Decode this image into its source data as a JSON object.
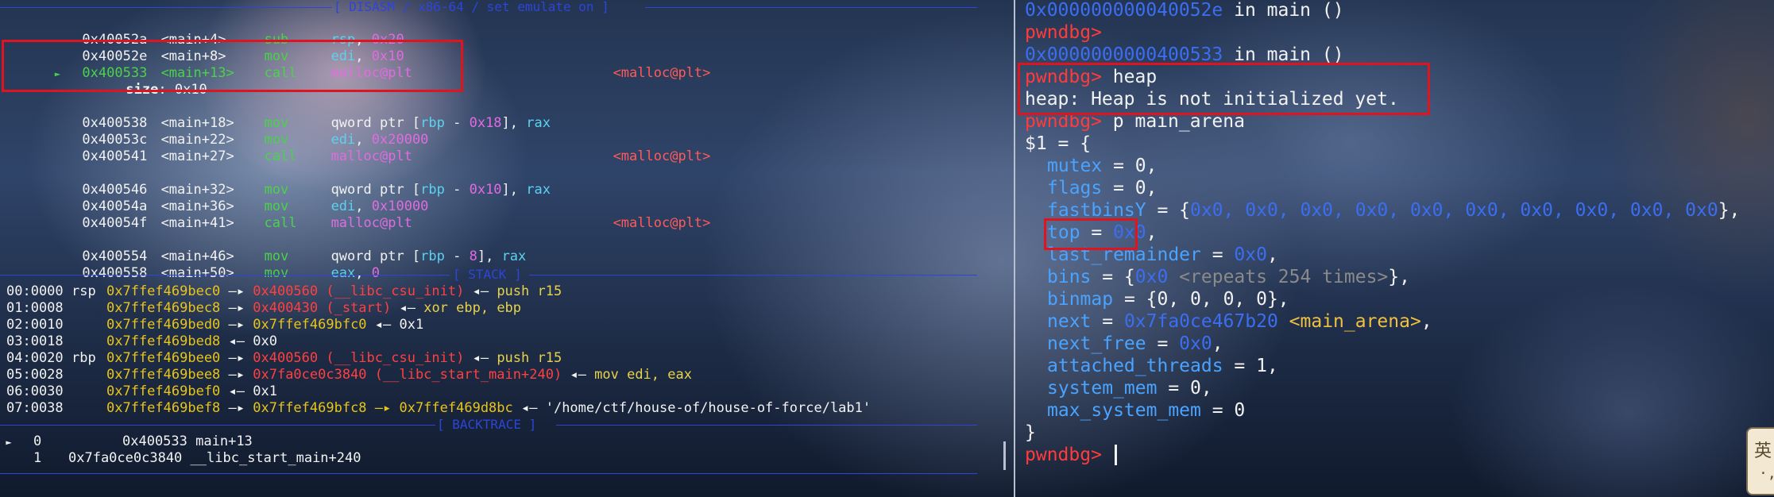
{
  "left": {
    "headers": {
      "disasm": "[ DISASM / x86-64 / set emulate on ]",
      "stack": "[ STACK ]",
      "backtrace": "[ BACKTRACE ]"
    },
    "disasm": [
      {
        "marker": "",
        "addr": "0x40052a",
        "sym": "<main+4>",
        "op": "sub",
        "a1": "rsp",
        "a2": ", ",
        "a3": "0x20",
        "extra": ""
      },
      {
        "marker": "",
        "addr": "0x40052e",
        "sym": "<main+8>",
        "op": "mov",
        "a1": "edi",
        "a2": ", ",
        "a3": "0x10",
        "extra": ""
      },
      {
        "marker": "►",
        "addr": "0x400533",
        "sym": "<main+13>",
        "op": "call",
        "a1": "malloc@plt",
        "a2": "",
        "a3": "",
        "extra": "<malloc@plt>"
      },
      {
        "marker": "",
        "addr": "",
        "sym": "",
        "op": "",
        "a1": "",
        "a2": "",
        "a3": "",
        "extra": "",
        "note_key": "size",
        "note_val": ": 0x10"
      },
      {
        "marker": "",
        "addr": "0x400538",
        "sym": "<main+18>",
        "op": "mov",
        "a1": "qword ptr [",
        "a1b": "rbp",
        "a1c": " - ",
        "a1d": "0x18",
        "a1e": "], ",
        "a1f": "rax",
        "extra": ""
      },
      {
        "marker": "",
        "addr": "0x40053c",
        "sym": "<main+22>",
        "op": "mov",
        "a1": "edi",
        "a2": ", ",
        "a3": "0x20000",
        "extra": ""
      },
      {
        "marker": "",
        "addr": "0x400541",
        "sym": "<main+27>",
        "op": "call",
        "a1": "malloc@plt",
        "a2": "",
        "a3": "",
        "extra": "<malloc@plt>"
      },
      {
        "marker": "",
        "addr": "0x400546",
        "sym": "<main+32>",
        "op": "mov",
        "a1": "qword ptr [",
        "a1b": "rbp",
        "a1c": " - ",
        "a1d": "0x10",
        "a1e": "], ",
        "a1f": "rax",
        "extra": ""
      },
      {
        "marker": "",
        "addr": "0x40054a",
        "sym": "<main+36>",
        "op": "mov",
        "a1": "edi",
        "a2": ", ",
        "a3": "0x10000",
        "extra": ""
      },
      {
        "marker": "",
        "addr": "0x40054f",
        "sym": "<main+41>",
        "op": "call",
        "a1": "malloc@plt",
        "a2": "",
        "a3": "",
        "extra": "<malloc@plt>"
      },
      {
        "marker": "",
        "addr": "0x400554",
        "sym": "<main+46>",
        "op": "mov",
        "a1": "qword ptr [",
        "a1b": "rbp",
        "a1c": " - ",
        "a1d": "8",
        "a1e": "], ",
        "a1f": "rax",
        "extra": ""
      },
      {
        "marker": "",
        "addr": "0x400558",
        "sym": "<main+50>",
        "op": "mov",
        "a1": "eax",
        "a2": ", ",
        "a3": "0",
        "extra": ""
      }
    ],
    "stack": [
      {
        "off": "00:0000",
        "reg": "rsp",
        "addr": "0x7ffef469bec0",
        "arrow": " —▸ ",
        "target": "0x400560 (__libc_csu_init)",
        "tail_arrow": " ◂— ",
        "tail": "push r15"
      },
      {
        "off": "01:0008",
        "reg": "",
        "addr": "0x7ffef469bec8",
        "arrow": " —▸ ",
        "target": "0x400430 (_start)",
        "tail_arrow": " ◂— ",
        "tail": "xor ebp, ebp"
      },
      {
        "off": "02:0010",
        "reg": "",
        "addr": "0x7ffef469bed0",
        "arrow": " —▸ ",
        "target": "0x7ffef469bfc0",
        "tail_arrow": " ◂— ",
        "tail": "0x1"
      },
      {
        "off": "03:0018",
        "reg": "",
        "addr": "0x7ffef469bed8",
        "arrow": "",
        "target": "",
        "tail_arrow": " ◂— ",
        "tail": "0x0"
      },
      {
        "off": "04:0020",
        "reg": "rbp",
        "addr": "0x7ffef469bee0",
        "arrow": " —▸ ",
        "target": "0x400560 (__libc_csu_init)",
        "tail_arrow": " ◂— ",
        "tail": "push r15"
      },
      {
        "off": "05:0028",
        "reg": "",
        "addr": "0x7ffef469bee8",
        "arrow": " —▸ ",
        "target": "0x7fa0ce0c3840 (__libc_start_main+240)",
        "tail_arrow": " ◂— ",
        "tail": "mov edi, eax"
      },
      {
        "off": "06:0030",
        "reg": "",
        "addr": "0x7ffef469bef0",
        "arrow": "",
        "target": "",
        "tail_arrow": " ◂— ",
        "tail": "0x1"
      },
      {
        "off": "07:0038",
        "reg": "",
        "addr": "0x7ffef469bef8",
        "arrow": " —▸ ",
        "target": "0x7ffef469bfc8 —▸ 0x7ffef469d8bc",
        "tail_arrow": " ◂— ",
        "tail": "'/home/ctf/house-of/house-of-force/lab1'"
      }
    ],
    "backtrace": [
      {
        "marker": "►",
        "idx": "0",
        "addr": "0x400533",
        "fn": "main+13"
      },
      {
        "marker": "",
        "idx": "1",
        "addr": "0x7fa0ce0c3840",
        "fn": "__libc_start_main+240"
      }
    ]
  },
  "right": {
    "prompt": "pwndbg> ",
    "lines": {
      "frame1_addr": "0x000000000040052e",
      "frame1_rest": " in main ()",
      "prompt1": "pwndbg>",
      "frame2_addr": "0x0000000000400533",
      "frame2_rest": " in main ()",
      "cmd_heap": "heap",
      "heap_msg": "heap: Heap is not initialized yet.",
      "cmd_p": "p main_arena",
      "result_head": "$1 = {",
      "mutex_k": "mutex",
      "mutex_v": " = 0,",
      "flags_k": "flags",
      "flags_v": " = 0,",
      "fastbins_k": "fastbinsY",
      "fastbins_pre": " = {",
      "fastbins_vals": "0x0, 0x0, 0x0, 0x0, 0x0, 0x0, 0x0, 0x0, 0x0, 0x0",
      "fastbins_post": "},",
      "top_k": "top",
      "top_eq": " = ",
      "top_v": "0x0",
      "top_post": ",",
      "lr_k": "last_remainder",
      "lr_eq": " = ",
      "lr_v": "0x0",
      "lr_post": ",",
      "bins_k": "bins",
      "bins_pre": " = {",
      "bins_v": "0x0",
      "bins_rep": " <repeats 254 times>",
      "bins_post": "},",
      "binmap_k": "binmap",
      "binmap_v": " = {0, 0, 0, 0},",
      "next_k": "next",
      "next_eq": " = ",
      "next_v": "0x7fa0ce467b20",
      "next_sym": " <main_arena>",
      "next_post": ",",
      "nextfree_k": "next_free",
      "nextfree_eq": " = ",
      "nextfree_v": "0x0",
      "nextfree_post": ",",
      "at_k": "attached_threads",
      "at_v": " = 1,",
      "sm_k": "system_mem",
      "sm_v": " = 0,",
      "msm_k": "max_system_mem",
      "msm_v": " = 0",
      "close": "}",
      "prompt_last": "pwndbg> "
    }
  },
  "ime": {
    "label": "英",
    "sub": "·,"
  },
  "colors": {
    "prompt": "#ff3b3b",
    "address": "#3b6ef0",
    "field": "#4aa3ff",
    "highlight_box": "#e0141e",
    "separator": "#2d45d8"
  }
}
